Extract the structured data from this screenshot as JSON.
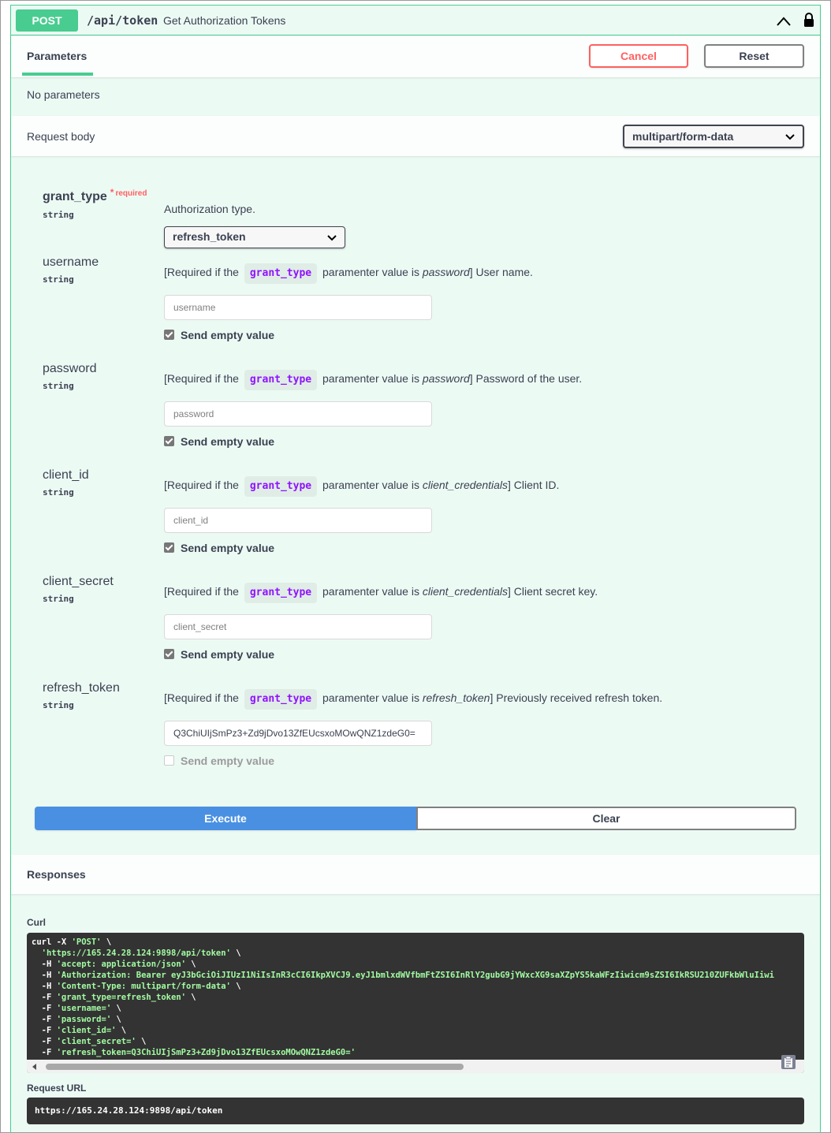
{
  "operation": {
    "method": "POST",
    "path": "/api/token",
    "summary": "Get Authorization Tokens"
  },
  "parameters": {
    "tab_label": "Parameters",
    "cancel_label": "Cancel",
    "reset_label": "Reset",
    "empty_text": "No parameters"
  },
  "request_body": {
    "title": "Request body",
    "content_type": "multipart/form-data"
  },
  "fields": [
    {
      "name": "grant_type",
      "type": "string",
      "required_mark": "*",
      "required_text": "required",
      "description": "Authorization type.",
      "selected": "refresh_token"
    },
    {
      "name": "username",
      "type": "string",
      "desc_prefix": "[Required if the",
      "desc_code": "grant_type",
      "desc_mid": "paramenter value is",
      "desc_italic": "password",
      "desc_suffix": "] User name.",
      "placeholder": "username",
      "send_empty_label": "Send empty value"
    },
    {
      "name": "password",
      "type": "string",
      "desc_prefix": "[Required if the",
      "desc_code": "grant_type",
      "desc_mid": "paramenter value is",
      "desc_italic": "password",
      "desc_suffix": "] Password of the user.",
      "placeholder": "password",
      "send_empty_label": "Send empty value"
    },
    {
      "name": "client_id",
      "type": "string",
      "desc_prefix": "[Required if the",
      "desc_code": "grant_type",
      "desc_mid": "paramenter value is",
      "desc_italic": "client_credentials",
      "desc_suffix": "] Client ID.",
      "placeholder": "client_id",
      "send_empty_label": "Send empty value"
    },
    {
      "name": "client_secret",
      "type": "string",
      "desc_prefix": "[Required if the",
      "desc_code": "grant_type",
      "desc_mid": "paramenter value is",
      "desc_italic": "client_credentials",
      "desc_suffix": "] Client secret key.",
      "placeholder": "client_secret",
      "send_empty_label": "Send empty value"
    },
    {
      "name": "refresh_token",
      "type": "string",
      "desc_prefix": "[Required if the",
      "desc_code": "grant_type",
      "desc_mid": "paramenter value is",
      "desc_italic": "refresh_token",
      "desc_suffix": "] Previously received refresh token.",
      "value": "Q3ChiUIjSmPz3+Zd9jDvo13ZfEUcsxoMOwQNZ1zdeG0=",
      "send_empty_label": "Send empty value"
    }
  ],
  "actions": {
    "execute_label": "Execute",
    "clear_label": "Clear"
  },
  "responses": {
    "title": "Responses",
    "curl_label": "Curl",
    "curl_lines": [
      {
        "pre": "curl -X ",
        "str": "'POST'",
        "post": " \\"
      },
      {
        "pre": "  ",
        "str": "'https://165.24.28.124:9898/api/token'",
        "post": " \\"
      },
      {
        "pre": "  -H ",
        "str": "'accept: application/json'",
        "post": " \\"
      },
      {
        "pre": "  -H ",
        "str": "'Authorization: Bearer eyJ3bGciOiJIUzI1NiIsInR3cCI6IkpXVCJ9.eyJ1bmlxdWVfbmFtZSI6InRlY2gubG9jYWxcXG9saXZpYS5kaWFzIiwicm9sZSI6IkRSU210ZUFkbWluIiwi",
        "post": ""
      },
      {
        "pre": "  -H ",
        "str": "'Content-Type: multipart/form-data'",
        "post": " \\"
      },
      {
        "pre": "  -F ",
        "str": "'grant_type=refresh_token'",
        "post": " \\"
      },
      {
        "pre": "  -F ",
        "str": "'username='",
        "post": " \\"
      },
      {
        "pre": "  -F ",
        "str": "'password='",
        "post": " \\"
      },
      {
        "pre": "  -F ",
        "str": "'client_id='",
        "post": " \\"
      },
      {
        "pre": "  -F ",
        "str": "'client_secret='",
        "post": " \\"
      },
      {
        "pre": "  -F ",
        "str": "'refresh_token=Q3ChiUIjSmPz3+Zd9jDvo13ZfEUcsxoMOwQNZ1zdeG0='",
        "post": ""
      }
    ],
    "request_url_label": "Request URL",
    "request_url": "https://165.24.28.124:9898/api/token"
  },
  "icons": {
    "collapse": "chevron-up-icon",
    "lock": "lock-icon",
    "dropdown": "chevron-down-icon",
    "copy": "clipboard-copy-icon"
  },
  "colors": {
    "post": "#49cc90",
    "execute": "#4990e2",
    "cancel": "#ff6060",
    "code_text": "#9012fe",
    "curl_string": "#a2fca2"
  }
}
